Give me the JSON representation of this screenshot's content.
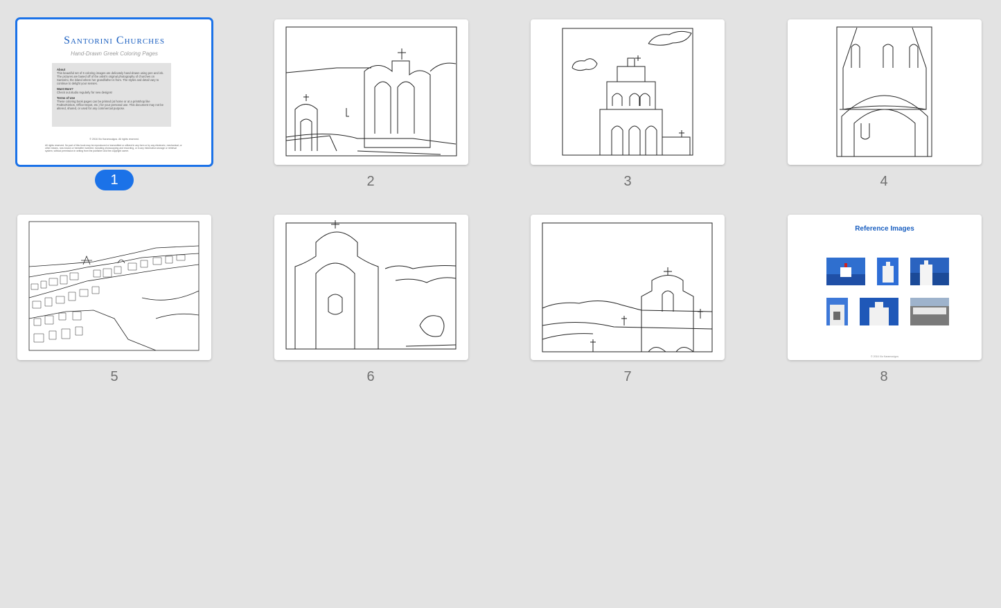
{
  "pages": [
    {
      "number": "1",
      "selected": true
    },
    {
      "number": "2"
    },
    {
      "number": "3"
    },
    {
      "number": "4"
    },
    {
      "number": "5"
    },
    {
      "number": "6"
    },
    {
      "number": "7"
    },
    {
      "number": "8"
    }
  ],
  "cover": {
    "title": "Santorini Churches",
    "subtitle": "Hand-Drawn Greek Coloring Pages",
    "about_heading": "About",
    "about_text": "This beautiful set of 6 coloring images are delicately hand-drawn using pen and ink. The pictures are based off of the artist's original photography of churches on Santorini, the island where her grandfather is from. The styles and detail vary to continue to delight your senses.",
    "more_heading": "Want More?",
    "more_text": "Check out.studio regularly for new designs!",
    "terms_heading": "Terms of Use",
    "terms_text": "These coloring book pages can be printed (at home or at a printshop like FedEx/Kinkos, Office Depot, etc.) for your personal use. This document may not be altered, shared, or used for any commercial purpose.",
    "copyright": "© 2016 Xio Karamoulgos. All rights reserved.",
    "legal": "All rights reserved. No part of this book may be reproduced or transmitted or utilized in any form or by any electronic, mechanical, or other means, now known or hereafter invented, including photocopying and recording, or in any information storage or retrieval system, without permission in writing from the publisher and the copyright owner."
  },
  "reference": {
    "title": "Reference Images",
    "copyright": "© 2016 Xio Karamoulgos"
  },
  "colors": {
    "selection": "#1b72e8",
    "background": "#e3e3e3",
    "title_blue": "#1a5fc0"
  }
}
